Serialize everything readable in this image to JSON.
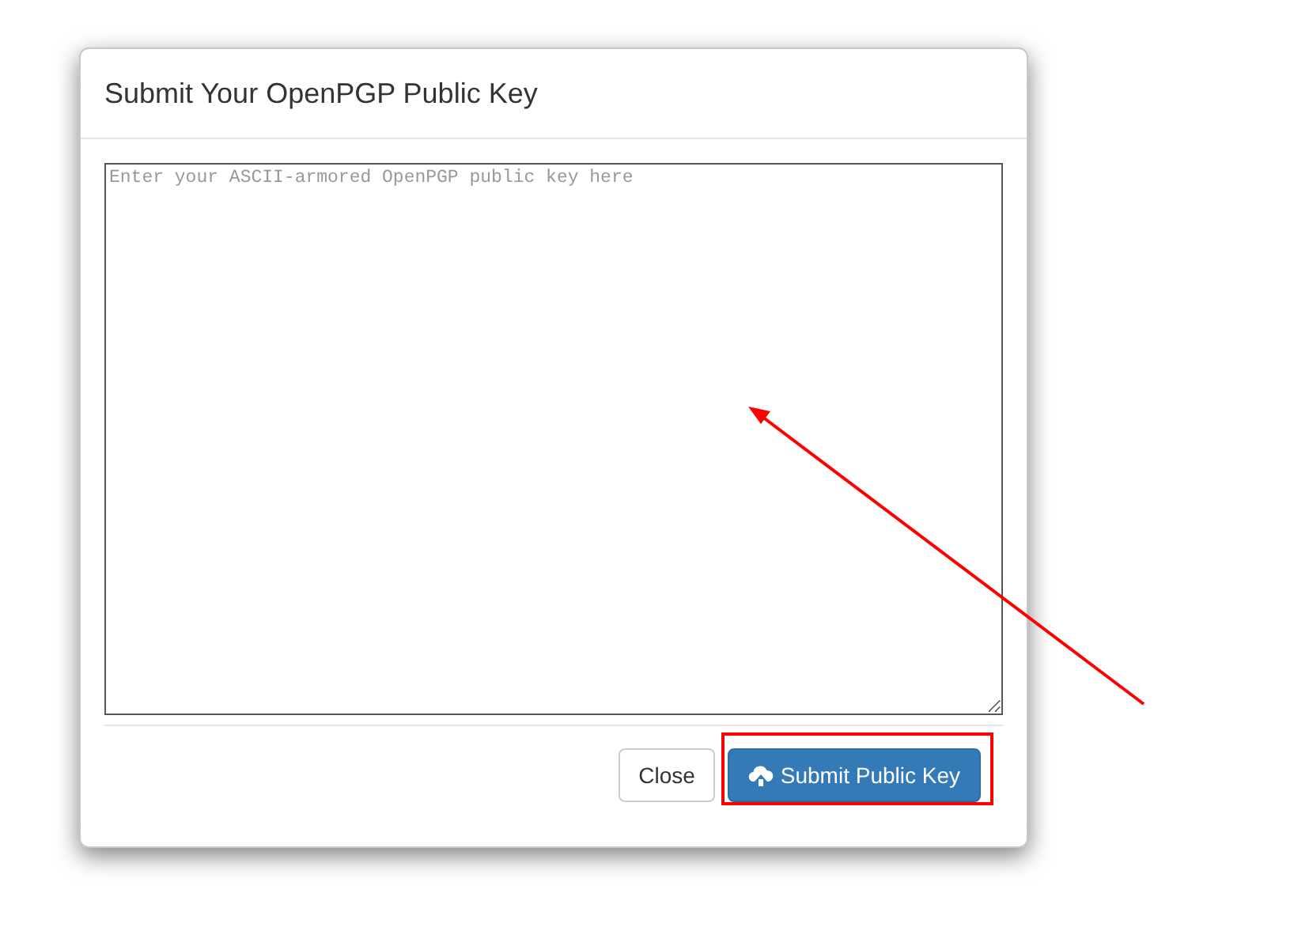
{
  "dialog": {
    "title": "Submit Your OpenPGP Public Key"
  },
  "key_field": {
    "placeholder": "Enter your ASCII-armored OpenPGP public key here"
  },
  "buttons": [
    {
      "label": "Close",
      "kind": "default"
    },
    {
      "label": "Submit Public Key",
      "kind": "primary"
    }
  ],
  "highlight": {
    "color": "#ff0000"
  },
  "arrow": {
    "color": "#ff0000"
  }
}
